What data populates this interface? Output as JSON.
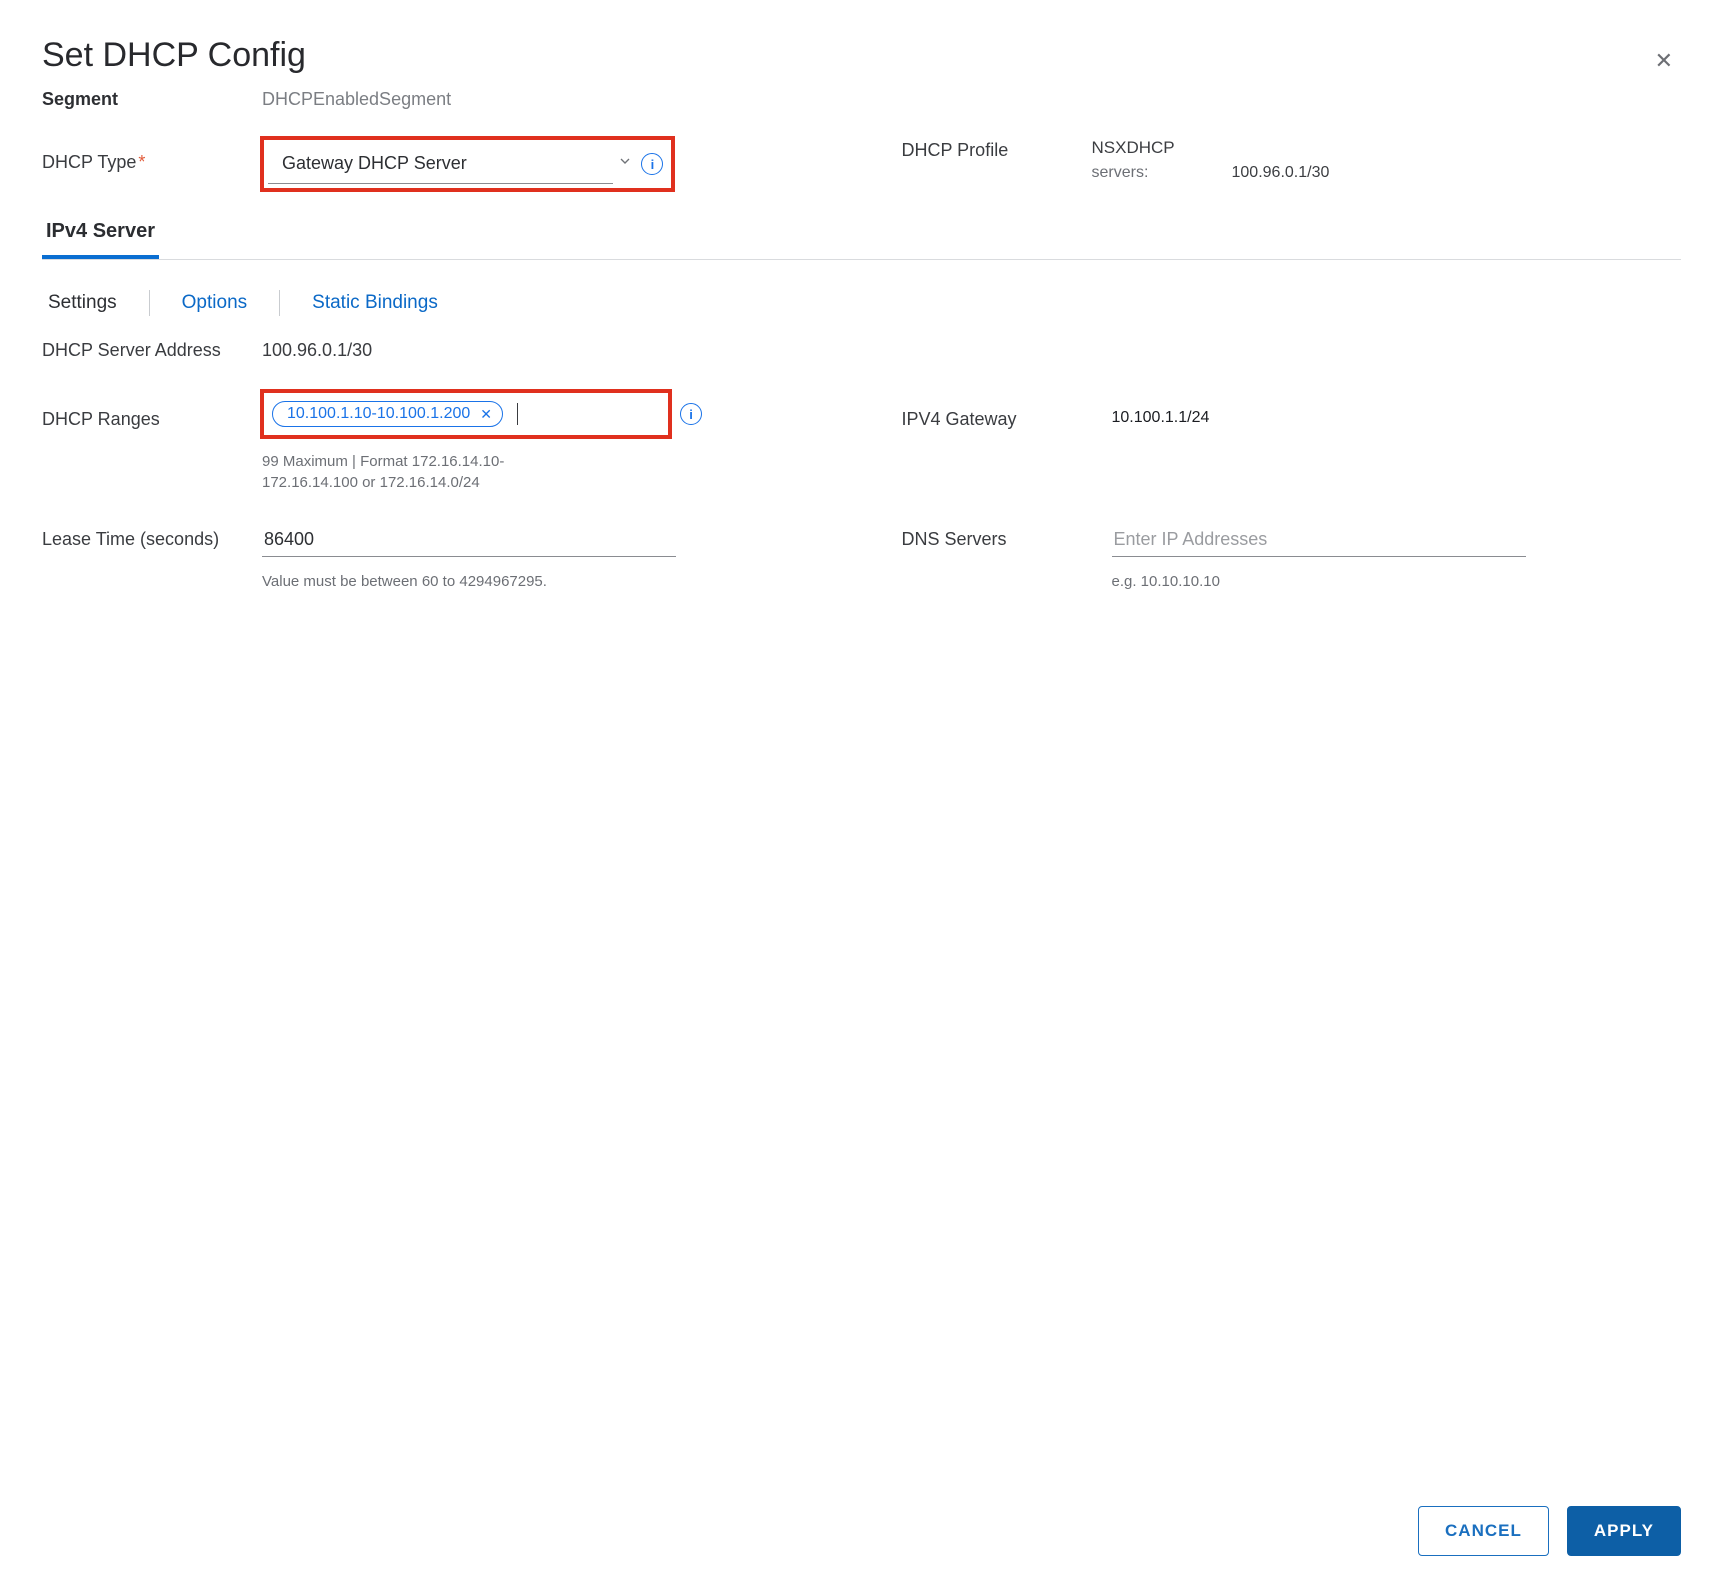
{
  "dialog": {
    "title": "Set DHCP Config",
    "close_icon": "close"
  },
  "segment": {
    "label": "Segment",
    "value": "DHCPEnabledSegment"
  },
  "dhcp_type": {
    "label": "DHCP Type",
    "required_mark": "*",
    "selected": "Gateway DHCP Server"
  },
  "dhcp_profile": {
    "label": "DHCP Profile",
    "value": "NSXDHCP",
    "servers_label": "servers:",
    "servers_value": "100.96.0.1/30"
  },
  "tabs": {
    "main": [
      "IPv4 Server"
    ],
    "active_main": "IPv4 Server",
    "sub": [
      "Settings",
      "Options",
      "Static Bindings"
    ],
    "active_sub": "Settings"
  },
  "server_address": {
    "label": "DHCP Server Address",
    "value": "100.96.0.1/30"
  },
  "ranges": {
    "label": "DHCP Ranges",
    "chips": [
      "10.100.1.10-10.100.1.200"
    ],
    "helper": "99 Maximum | Format 172.16.14.10-172.16.14.100 or 172.16.14.0/24"
  },
  "ipv4_gateway": {
    "label": "IPV4 Gateway",
    "value": "10.100.1.1/24"
  },
  "lease": {
    "label": "Lease Time (seconds)",
    "value": "86400",
    "helper": "Value must be between 60 to 4294967295."
  },
  "dns": {
    "label": "DNS Servers",
    "placeholder": "Enter IP Addresses",
    "helper": "e.g. 10.10.10.10"
  },
  "buttons": {
    "cancel": "Cancel",
    "apply": "Apply"
  }
}
